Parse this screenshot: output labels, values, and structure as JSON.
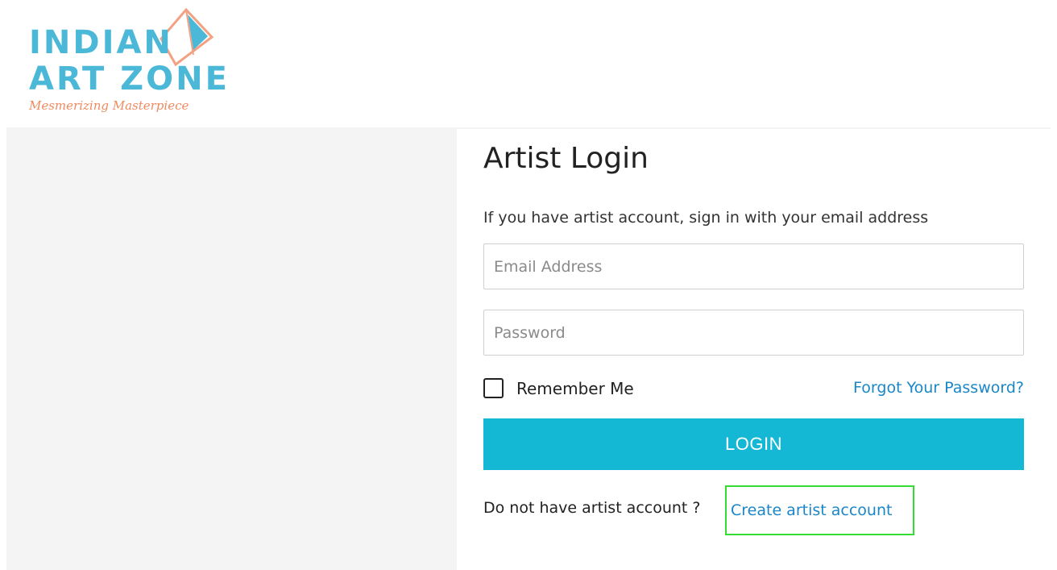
{
  "brand": {
    "line1": "INDIAN",
    "line2": "ART ZONE",
    "tagline": "Mesmerizing Masterpiece",
    "primary_color": "#4bb8d8",
    "accent_color": "#f08a60"
  },
  "login": {
    "title": "Artist Login",
    "subtitle": "If you have artist account, sign in with your email address",
    "email_placeholder": "Email Address",
    "password_placeholder": "Password",
    "remember_label": "Remember Me",
    "remember_checked": false,
    "forgot_label": "Forgot Your Password?",
    "button_label": "LOGIN",
    "button_color": "#15b8d4",
    "signup_prompt": "Do not have artist account ?",
    "signup_link": "Create artist account",
    "link_color": "#1a86c8",
    "highlight_color": "#33dd33"
  },
  "icons": {
    "logo_mark": "kite-icon",
    "checkbox": "checkbox-icon"
  }
}
